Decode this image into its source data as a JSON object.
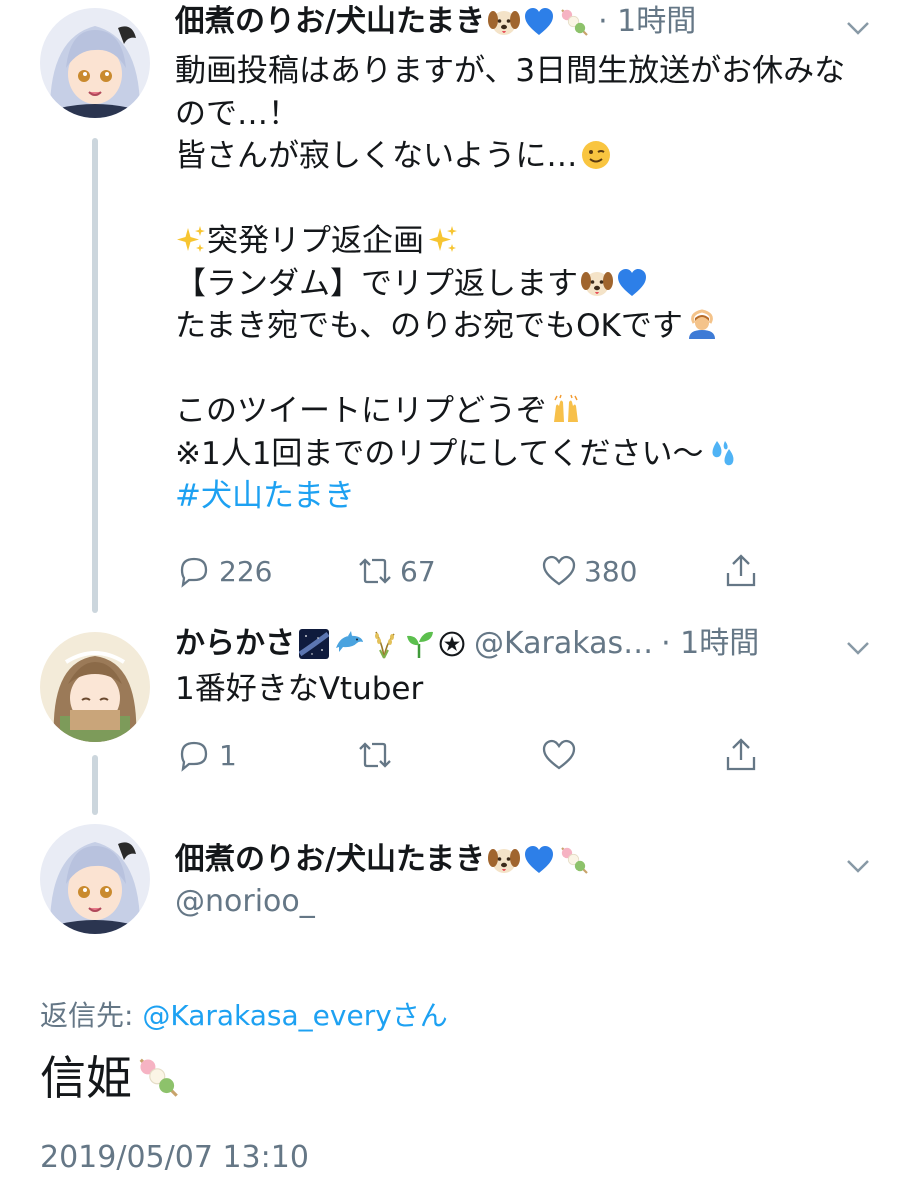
{
  "tweet1": {
    "author_name": "佃煮のりお/犬山たまき",
    "time": "· 1時間",
    "lines": [
      "動画投稿はありますが、3日間生放送がお休みな",
      "ので…！",
      "皆さんが寂しくないように…"
    ],
    "line_plan": "突発リプ返企画",
    "line_random": "【ランダム】でリプ返します",
    "line_ok": "たまき宛でも、のりお宛でもOKです",
    "line_please": "このツイートにリプどうぞ",
    "line_once": "※1人1回までのリプにしてください〜",
    "hashtag": "#犬山たまき",
    "replies": "226",
    "retweets": "67",
    "likes": "380"
  },
  "tweet2": {
    "author_name": "からかさ",
    "handle": "@Karakas…",
    "time": "· 1時間",
    "text": "1番好きなVtuber",
    "replies": "1"
  },
  "tweet3": {
    "author_name": "佃煮のりお/犬山たまき",
    "handle": "@norioo_",
    "reply_prefix": "返信先: ",
    "reply_mention": "@Karakasa_every",
    "reply_suffix": "さん",
    "text": "信姫",
    "timestamp": "2019/05/07 13:10"
  },
  "icons": [
    "dog-emoji",
    "blue-heart-emoji",
    "dango-emoji",
    "wink-emoji",
    "sparkles-emoji",
    "ok-person-emoji",
    "raising-hands-emoji",
    "sweat-droplets-emoji",
    "milky-way-emoji",
    "dolphin-emoji",
    "rice-emoji",
    "seedling-emoji",
    "reply-icon",
    "retweet-icon",
    "like-icon",
    "share-icon",
    "chevron-down-icon"
  ],
  "colors": {
    "link": "#1da1f2",
    "muted": "#657786",
    "thread_line": "#ccd6dd",
    "text": "#14171a"
  }
}
